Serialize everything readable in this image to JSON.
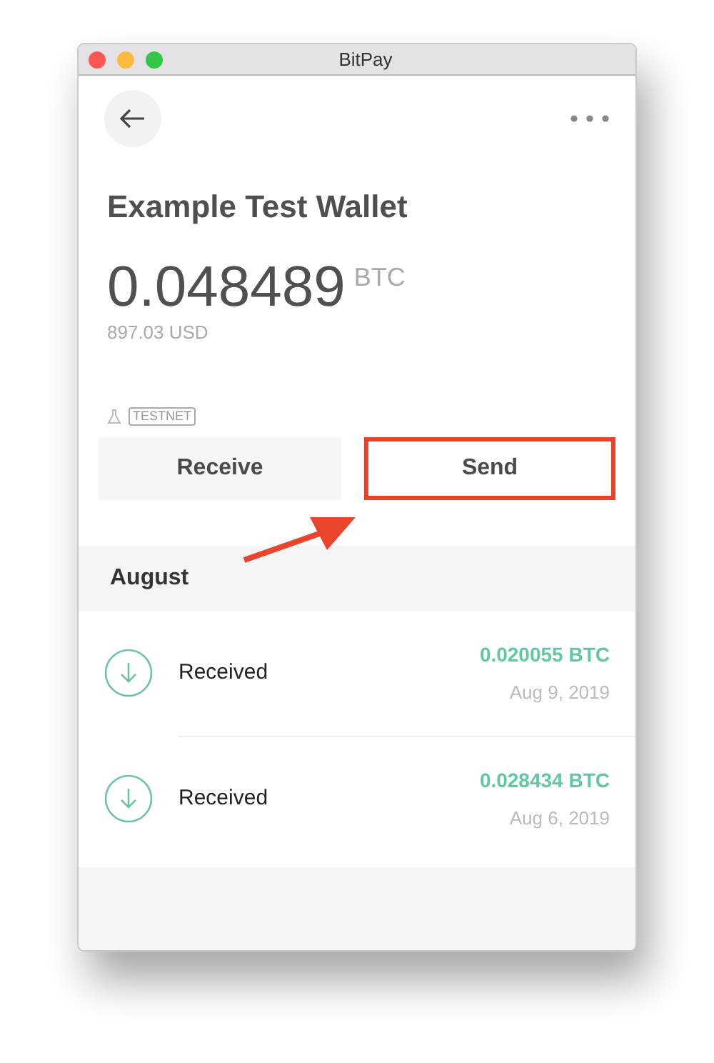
{
  "window": {
    "title": "BitPay"
  },
  "wallet": {
    "name": "Example Test Wallet",
    "balance": "0.048489",
    "unit": "BTC",
    "fiat": "897.03 USD",
    "network": "TESTNET"
  },
  "actions": [
    {
      "label": "Receive",
      "highlighted": false
    },
    {
      "label": "Send",
      "highlighted": true
    }
  ],
  "section": {
    "title": "August"
  },
  "transactions": [
    {
      "label": "Received",
      "amount": "0.020055 BTC",
      "date": "Aug 9, 2019"
    },
    {
      "label": "Received",
      "amount": "0.028434 BTC",
      "date": "Aug 6, 2019"
    }
  ]
}
